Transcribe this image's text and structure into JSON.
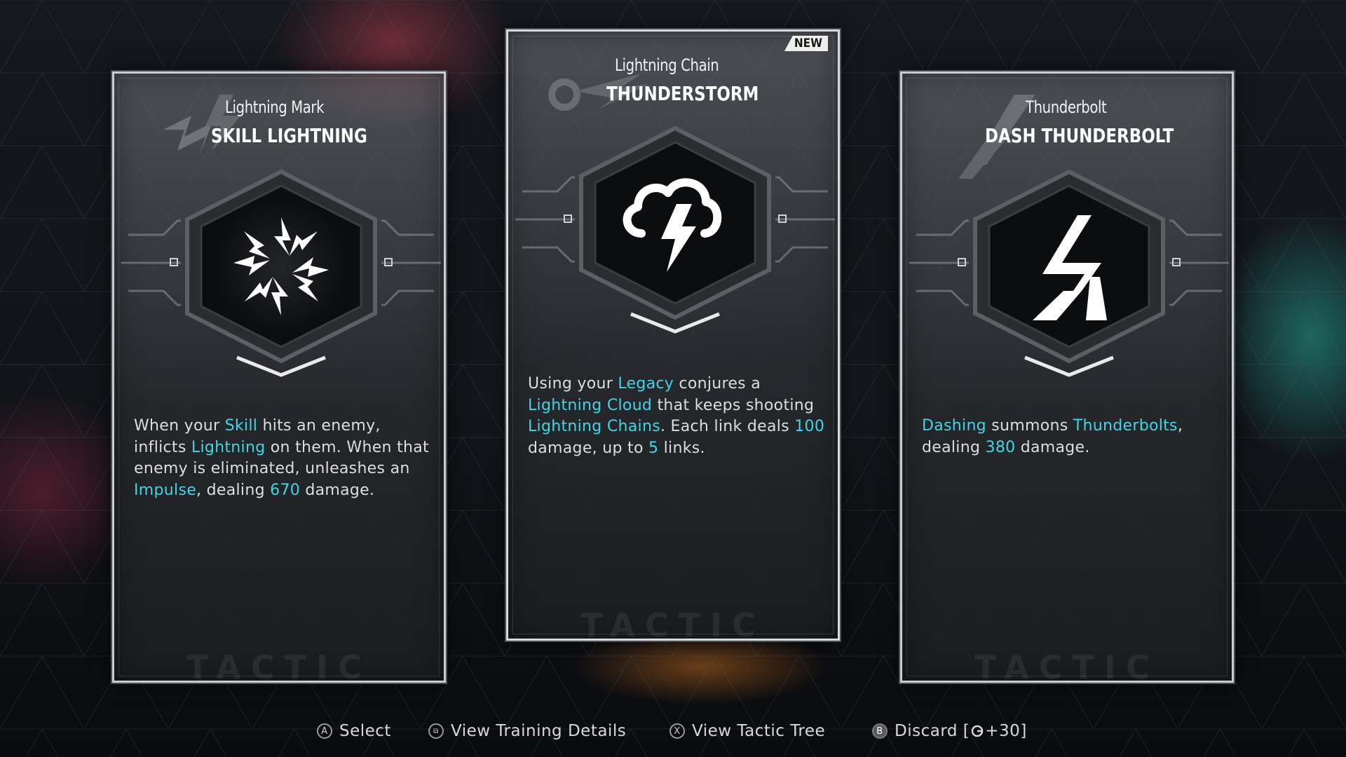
{
  "cards": [
    {
      "subtitle": "Lightning Mark",
      "title": "SKILL LIGHTNING",
      "icon": "lightning-burst-icon",
      "watermark": "TACTIC",
      "description": [
        {
          "t": "When your ",
          "h": false
        },
        {
          "t": "Skill",
          "h": true
        },
        {
          "t": " hits an enemy, inflicts ",
          "h": false
        },
        {
          "t": "Lightning",
          "h": true
        },
        {
          "t": " on them. When that enemy is eliminated, unleashes an ",
          "h": false
        },
        {
          "t": "Impulse",
          "h": true
        },
        {
          "t": ", dealing ",
          "h": false
        },
        {
          "t": "670",
          "h": true
        },
        {
          "t": " damage.",
          "h": false
        }
      ]
    },
    {
      "subtitle": "Lightning Chain",
      "title": "THUNDERSTORM",
      "badge": "NEW",
      "icon": "storm-cloud-icon",
      "watermark": "TACTIC",
      "description": [
        {
          "t": "Using your ",
          "h": false
        },
        {
          "t": "Legacy",
          "h": true
        },
        {
          "t": " conjures a ",
          "h": false
        },
        {
          "t": "Lightning Cloud",
          "h": true
        },
        {
          "t": " that keeps shooting ",
          "h": false
        },
        {
          "t": "Lightning Chains",
          "h": true
        },
        {
          "t": ". Each link deals ",
          "h": false
        },
        {
          "t": "100",
          "h": true
        },
        {
          "t": " damage, up to ",
          "h": false
        },
        {
          "t": "5",
          "h": true
        },
        {
          "t": " links.",
          "h": false
        }
      ]
    },
    {
      "subtitle": "Thunderbolt",
      "title": "DASH THUNDERBOLT",
      "icon": "thunderbolt-icon",
      "watermark": "TACTIC",
      "description": [
        {
          "t": "Dashing",
          "h": true
        },
        {
          "t": " summons ",
          "h": false
        },
        {
          "t": "Thunderbolts",
          "h": true
        },
        {
          "t": ", dealing ",
          "h": false
        },
        {
          "t": "380",
          "h": true
        },
        {
          "t": " damage.",
          "h": false
        }
      ]
    }
  ],
  "footer": {
    "select": {
      "glyph": "A",
      "label": "Select"
    },
    "details": {
      "glyph": "⧉",
      "label": "View Training Details"
    },
    "tree": {
      "glyph": "X",
      "label": "View Tactic Tree"
    },
    "discard": {
      "glyph": "B",
      "label": "Discard [",
      "currency_icon": "gear-coin-icon",
      "amount": "+30",
      "close": "]"
    }
  },
  "colors": {
    "highlight": "#3fd6e6",
    "text": "#dedede"
  }
}
